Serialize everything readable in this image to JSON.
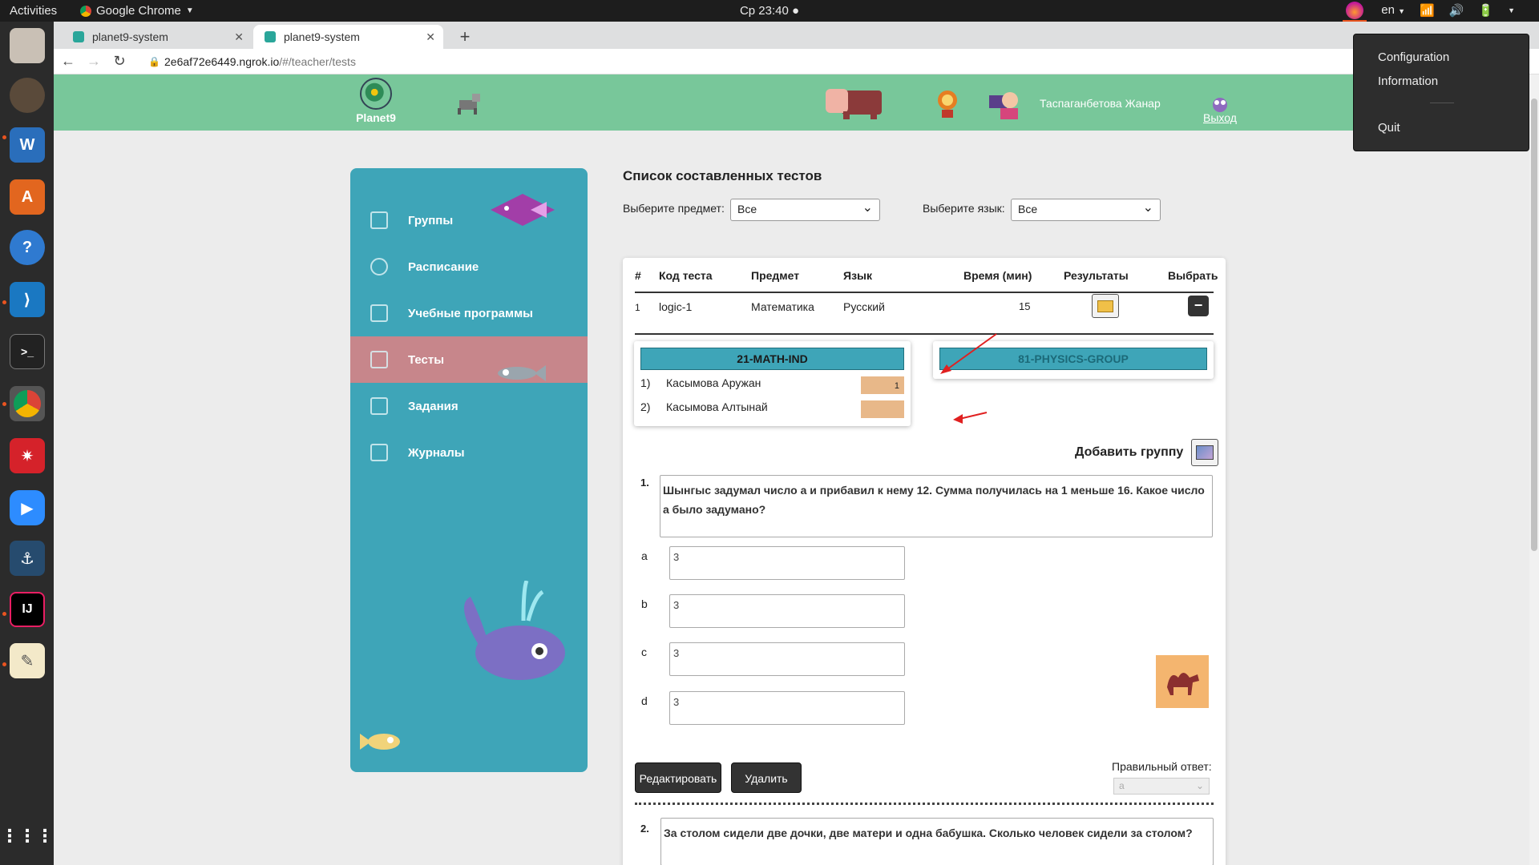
{
  "system": {
    "activities": "Activities",
    "app_name": "Google Chrome",
    "clock": "Ср 23:40",
    "keyboard_layout": "en"
  },
  "tray_menu": {
    "items": [
      "Configuration",
      "Information",
      "Quit"
    ]
  },
  "browser": {
    "tabs": [
      {
        "title": "planet9-system"
      },
      {
        "title": "planet9-system"
      }
    ],
    "url_host": "2e6af72e6449.ngrok.io",
    "url_path": "/#/teacher/tests"
  },
  "header": {
    "logo_text": "Planet9",
    "user_name": "Таспаганбетова Жанар",
    "logout": "Выход"
  },
  "sidebar": {
    "items": [
      {
        "label": "Группы"
      },
      {
        "label": "Расписание"
      },
      {
        "label": "Учебные программы"
      },
      {
        "label": "Тесты"
      },
      {
        "label": "Задания"
      },
      {
        "label": "Журналы"
      }
    ]
  },
  "main": {
    "title": "Список составленных тестов",
    "subject_label": "Выберите предмет:",
    "subject_value": "Все",
    "language_label": "Выберите язык:",
    "language_value": "Все",
    "table": {
      "headers": [
        "#",
        "Код теста",
        "Предмет",
        "Язык",
        "Время (мин)",
        "Результаты",
        "Выбрать"
      ],
      "row": {
        "num": "1",
        "code": "logic-1",
        "subject": "Математика",
        "language": "Русский",
        "time": "15"
      }
    },
    "groups": [
      {
        "name": "21-MATH-IND",
        "students": [
          {
            "num": "1)",
            "name": "Касымова Аружан",
            "score": "1"
          },
          {
            "num": "2)",
            "name": "Касымова Алтынай",
            "score": ""
          }
        ]
      },
      {
        "name": "81-PHYSICS-GROUP",
        "students": []
      }
    ],
    "add_group": "Добавить группу",
    "questions": [
      {
        "num": "1.",
        "text": "Шынгыс задумал число а и прибавил к нему 12. Сумма получилась на 1 меньше 16. Какое число а было задумано?",
        "options": [
          {
            "label": "a",
            "value": "3"
          },
          {
            "label": "b",
            "value": "3"
          },
          {
            "label": "c",
            "value": "3"
          },
          {
            "label": "d",
            "value": "3"
          }
        ],
        "edit": "Редактировать",
        "delete": "Удалить",
        "correct_label": "Правильный ответ:",
        "correct_value": "a"
      },
      {
        "num": "2.",
        "text": "За столом сидели две дочки, две матери и одна бабушка. Сколько человек сидели за столом?"
      }
    ]
  }
}
